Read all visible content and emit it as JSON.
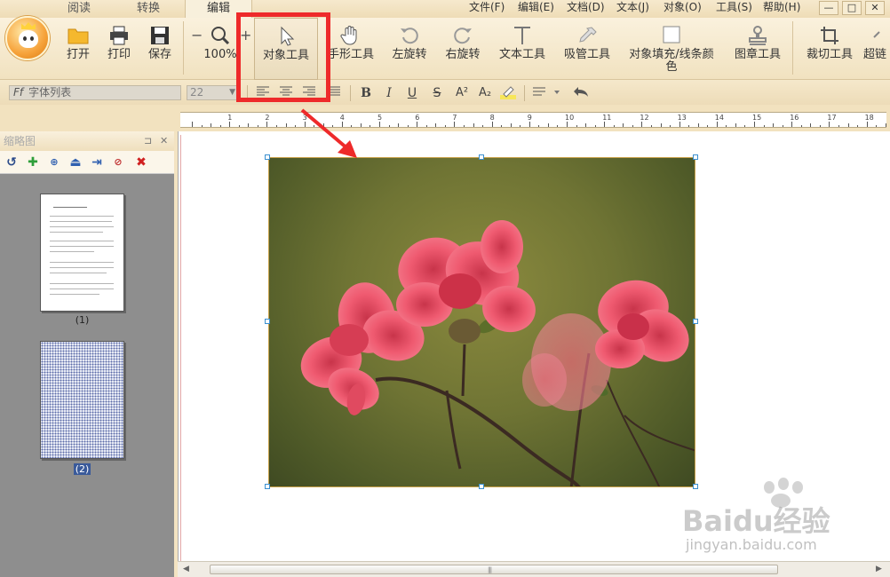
{
  "tabs": [
    "阅读",
    "转换",
    "编辑"
  ],
  "menus": [
    "文件(F)",
    "编辑(E)",
    "文档(D)",
    "文本(J)",
    "对象(O)",
    "工具(S)",
    "帮助(H)"
  ],
  "window_buttons": [
    "—",
    "□",
    "✕"
  ],
  "toolbar": {
    "open": "打开",
    "print": "打印",
    "save": "保存",
    "zoom_out": "−",
    "zoom": "100%",
    "zoom_in": "+",
    "object_tool": "对象工具",
    "hand_tool": "手形工具",
    "rotate_left": "左旋转",
    "rotate_right": "右旋转",
    "text_tool": "文本工具",
    "eyedropper_tool": "吸管工具",
    "fill_stroke_color": "对象填充/线条颜色",
    "stamp_tool": "图章工具",
    "crop_tool": "裁切工具",
    "more": "超链"
  },
  "format_bar": {
    "font_placeholder": "字体列表",
    "font_size": "22",
    "bold": "B",
    "italic": "I",
    "underline": "U",
    "strike": "S",
    "superscript": "A²",
    "subscript": "A₂"
  },
  "ruler_numbers": [
    "1",
    "2",
    "3",
    "4",
    "5",
    "6",
    "7",
    "8",
    "9",
    "10",
    "11",
    "12",
    "13",
    "14",
    "15",
    "16",
    "17",
    "18"
  ],
  "thumbnail_panel": {
    "title": "缩略图",
    "pages": [
      {
        "label": "(1)"
      },
      {
        "label": "(2)"
      }
    ]
  },
  "watermark": {
    "brand": "Baidu经验",
    "site": "jingyan.baidu.com"
  },
  "colors": {
    "highlight": "#ee2a2a",
    "ribbon": "#f4e6c6",
    "accent": "#f6a23a"
  }
}
